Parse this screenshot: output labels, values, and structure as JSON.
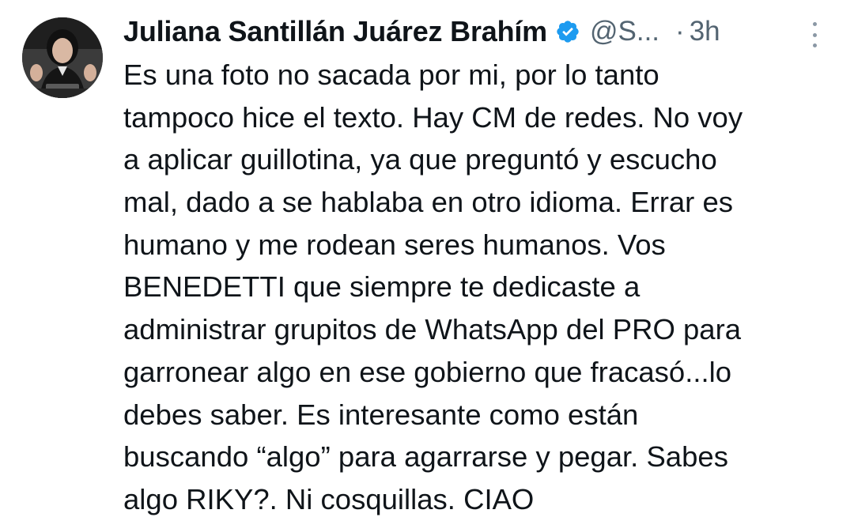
{
  "author": {
    "display_name": "Juliana Santillán Juárez Brahím",
    "handle": "@S...",
    "verified": true,
    "avatar_icon": "profile-photo"
  },
  "meta": {
    "separator": "·",
    "time": "3h"
  },
  "more_icon": "more-vertical-icon",
  "colors": {
    "text": "#0f1419",
    "secondary": "#536471",
    "verified": "#1d9bf0"
  },
  "tweet": {
    "lines": [
      "Es una foto no sacada por mi, por lo tanto",
      "tampoco hice el texto. Hay CM de redes.  No voy",
      "a aplicar guillotina, ya que preguntó y escucho",
      "mal, dado a se hablaba en otro idioma. Errar es",
      "humano y me rodean seres humanos. Vos",
      "BENEDETTI que siempre te dedicaste a",
      "administrar grupitos de WhatsApp del PRO para",
      "garronear algo en ese gobierno que fracasó...lo",
      "debes saber. Es interesante como están",
      "buscando “algo” para agarrarse y pegar. Sabes",
      "algo RIKY?. Ni cosquillas. CIAO"
    ]
  }
}
